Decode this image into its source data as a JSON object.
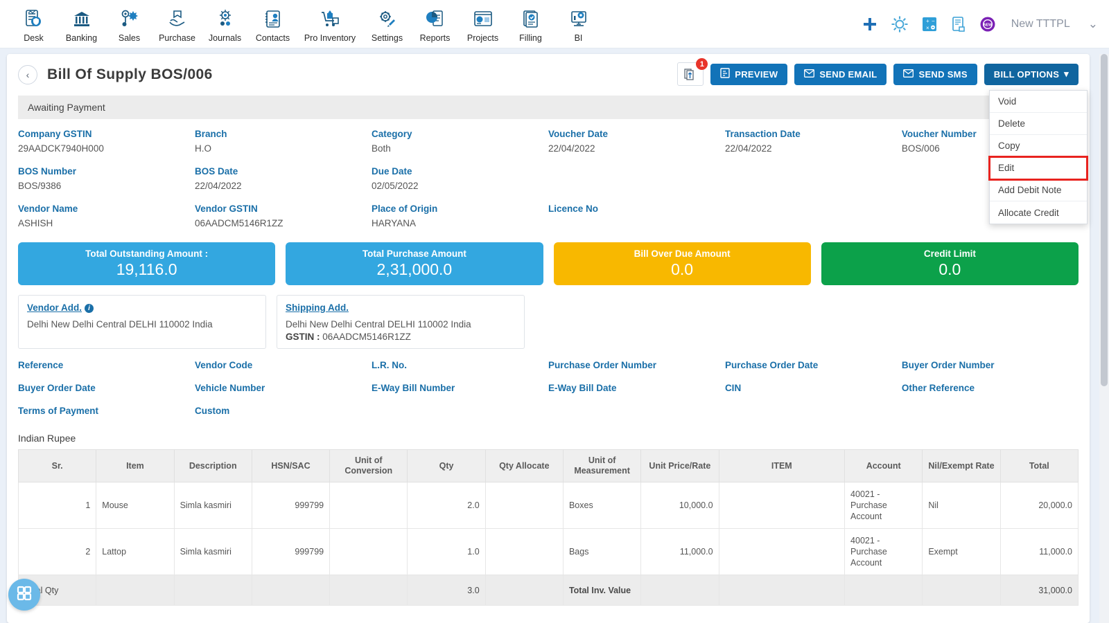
{
  "nav": {
    "items": [
      {
        "label": "Desk",
        "icon": "dashboard-icon"
      },
      {
        "label": "Banking",
        "icon": "bank-icon"
      },
      {
        "label": "Sales",
        "icon": "sales-icon"
      },
      {
        "label": "Purchase",
        "icon": "purchase-icon"
      },
      {
        "label": "Journals",
        "icon": "journals-icon"
      },
      {
        "label": "Contacts",
        "icon": "contacts-icon"
      },
      {
        "label": "Pro Inventory",
        "icon": "inventory-icon"
      },
      {
        "label": "Settings",
        "icon": "settings-icon"
      },
      {
        "label": "Reports",
        "icon": "reports-icon"
      },
      {
        "label": "Projects",
        "icon": "projects-icon"
      },
      {
        "label": "Filling",
        "icon": "filling-icon"
      },
      {
        "label": "BI",
        "icon": "bi-icon"
      }
    ],
    "right": {
      "add_icon": "plus-icon",
      "settings_icon": "gear-icon",
      "calculator_icon": "calculator-icon",
      "notes_icon": "notes-icon",
      "new_icon": "new-badge-icon",
      "org": "New TTTPL",
      "chevron": "chevron-down-icon"
    }
  },
  "header": {
    "back_icon": "chevron-left-icon",
    "title": "Bill Of Supply BOS/006",
    "attach_icon": "attachment-icon",
    "attach_badge": "1",
    "preview_label": "PREVIEW",
    "send_email_label": "SEND EMAIL",
    "send_sms_label": "SEND SMS",
    "bill_options_label": "BILL OPTIONS"
  },
  "bill_options_menu": {
    "items": [
      {
        "label": "Void",
        "highlighted": false
      },
      {
        "label": "Delete",
        "highlighted": false
      },
      {
        "label": "Copy",
        "highlighted": false
      },
      {
        "label": "Edit",
        "highlighted": true
      },
      {
        "label": "Add Debit Note",
        "highlighted": false
      },
      {
        "label": "Allocate Credit",
        "highlighted": false
      }
    ]
  },
  "status": {
    "text": "Awaiting Payment"
  },
  "fields": {
    "row1": [
      {
        "label": "Company GSTIN",
        "value": "29AADCK7940H000"
      },
      {
        "label": "Branch",
        "value": "H.O"
      },
      {
        "label": "Category",
        "value": "Both"
      },
      {
        "label": "Voucher Date",
        "value": "22/04/2022"
      },
      {
        "label": "Transaction Date",
        "value": "22/04/2022"
      },
      {
        "label": "Voucher Number",
        "value": "BOS/006"
      }
    ],
    "row2": [
      {
        "label": "BOS Number",
        "value": "BOS/9386"
      },
      {
        "label": "BOS Date",
        "value": "22/04/2022"
      },
      {
        "label": "Due Date",
        "value": "02/05/2022"
      },
      {
        "label": "",
        "value": ""
      },
      {
        "label": "",
        "value": ""
      },
      {
        "label": "",
        "value": ""
      }
    ],
    "row3": [
      {
        "label": "Vendor Name",
        "value": "ASHISH"
      },
      {
        "label": "Vendor GSTIN",
        "value": "06AADCM5146R1ZZ"
      },
      {
        "label": "Place of Origin",
        "value": "HARYANA"
      },
      {
        "label": "Licence No",
        "value": ""
      },
      {
        "label": "",
        "value": ""
      },
      {
        "label": "",
        "value": ""
      }
    ]
  },
  "summary_cards": [
    {
      "title": "Total Outstanding Amount :",
      "value": "19,116.0",
      "color": "#33A7E0"
    },
    {
      "title": "Total Purchase Amount",
      "value": "2,31,000.0",
      "color": "#33A7E0"
    },
    {
      "title": "Bill Over Due Amount",
      "value": "0.0",
      "color": "#F8B800"
    },
    {
      "title": "Credit Limit",
      "value": "0.0",
      "color": "#0CA14A"
    }
  ],
  "addresses": {
    "vendor": {
      "title": "Vendor Add.",
      "info_icon": "info-icon",
      "line": "Delhi New Delhi Central DELHI 110002 India"
    },
    "shipping": {
      "title": "Shipping Add.",
      "line": "Delhi New Delhi Central DELHI 110002 India",
      "gstin_label": "GSTIN :",
      "gstin_value": "06AADCM5146R1ZZ"
    }
  },
  "ref_labels": {
    "row1": [
      "Reference",
      "Vendor Code",
      "L.R. No.",
      "Purchase Order Number",
      "Purchase Order Date",
      "Buyer Order Number"
    ],
    "row2": [
      "Buyer Order Date",
      "Vehicle Number",
      "E-Way Bill Number",
      "E-Way Bill Date",
      "CIN",
      "Other Reference"
    ],
    "row3": [
      "Terms of Payment",
      "Custom",
      "",
      "",
      "",
      ""
    ]
  },
  "table": {
    "currency": "Indian Rupee",
    "columns": [
      "Sr.",
      "Item",
      "Description",
      "HSN/SAC",
      "Unit of Conversion",
      "Qty",
      "Qty Allocate",
      "Unit of Measurement",
      "Unit Price/Rate",
      "ITEM",
      "Account",
      "Nil/Exempt Rate",
      "Total"
    ],
    "rows": [
      {
        "sr": "1",
        "item": "Mouse",
        "description": "Simla kasmiri",
        "hsn": "999799",
        "unit_of_conversion": "",
        "qty": "2.0",
        "qty_allocate": "",
        "unit_of_measurement": "Boxes",
        "unit_price": "10,000.0",
        "item2": "",
        "account": "40021 - Purchase Account",
        "nil_exempt": "Nil",
        "total": "20,000.0"
      },
      {
        "sr": "2",
        "item": "Lattop",
        "description": "Simla kasmiri",
        "hsn": "999799",
        "unit_of_conversion": "",
        "qty": "1.0",
        "qty_allocate": "",
        "unit_of_measurement": "Bags",
        "unit_price": "11,000.0",
        "item2": "",
        "account": "40021 - Purchase Account",
        "nil_exempt": "Exempt",
        "total": "11,000.0"
      }
    ],
    "footer": {
      "total_qty_label": "Total Qty",
      "total_qty_value": "3.0",
      "total_inv_label": "Total Inv. Value",
      "total_inv_value": "31,000.0"
    }
  },
  "fab": {
    "icon": "grid-apps-icon"
  }
}
